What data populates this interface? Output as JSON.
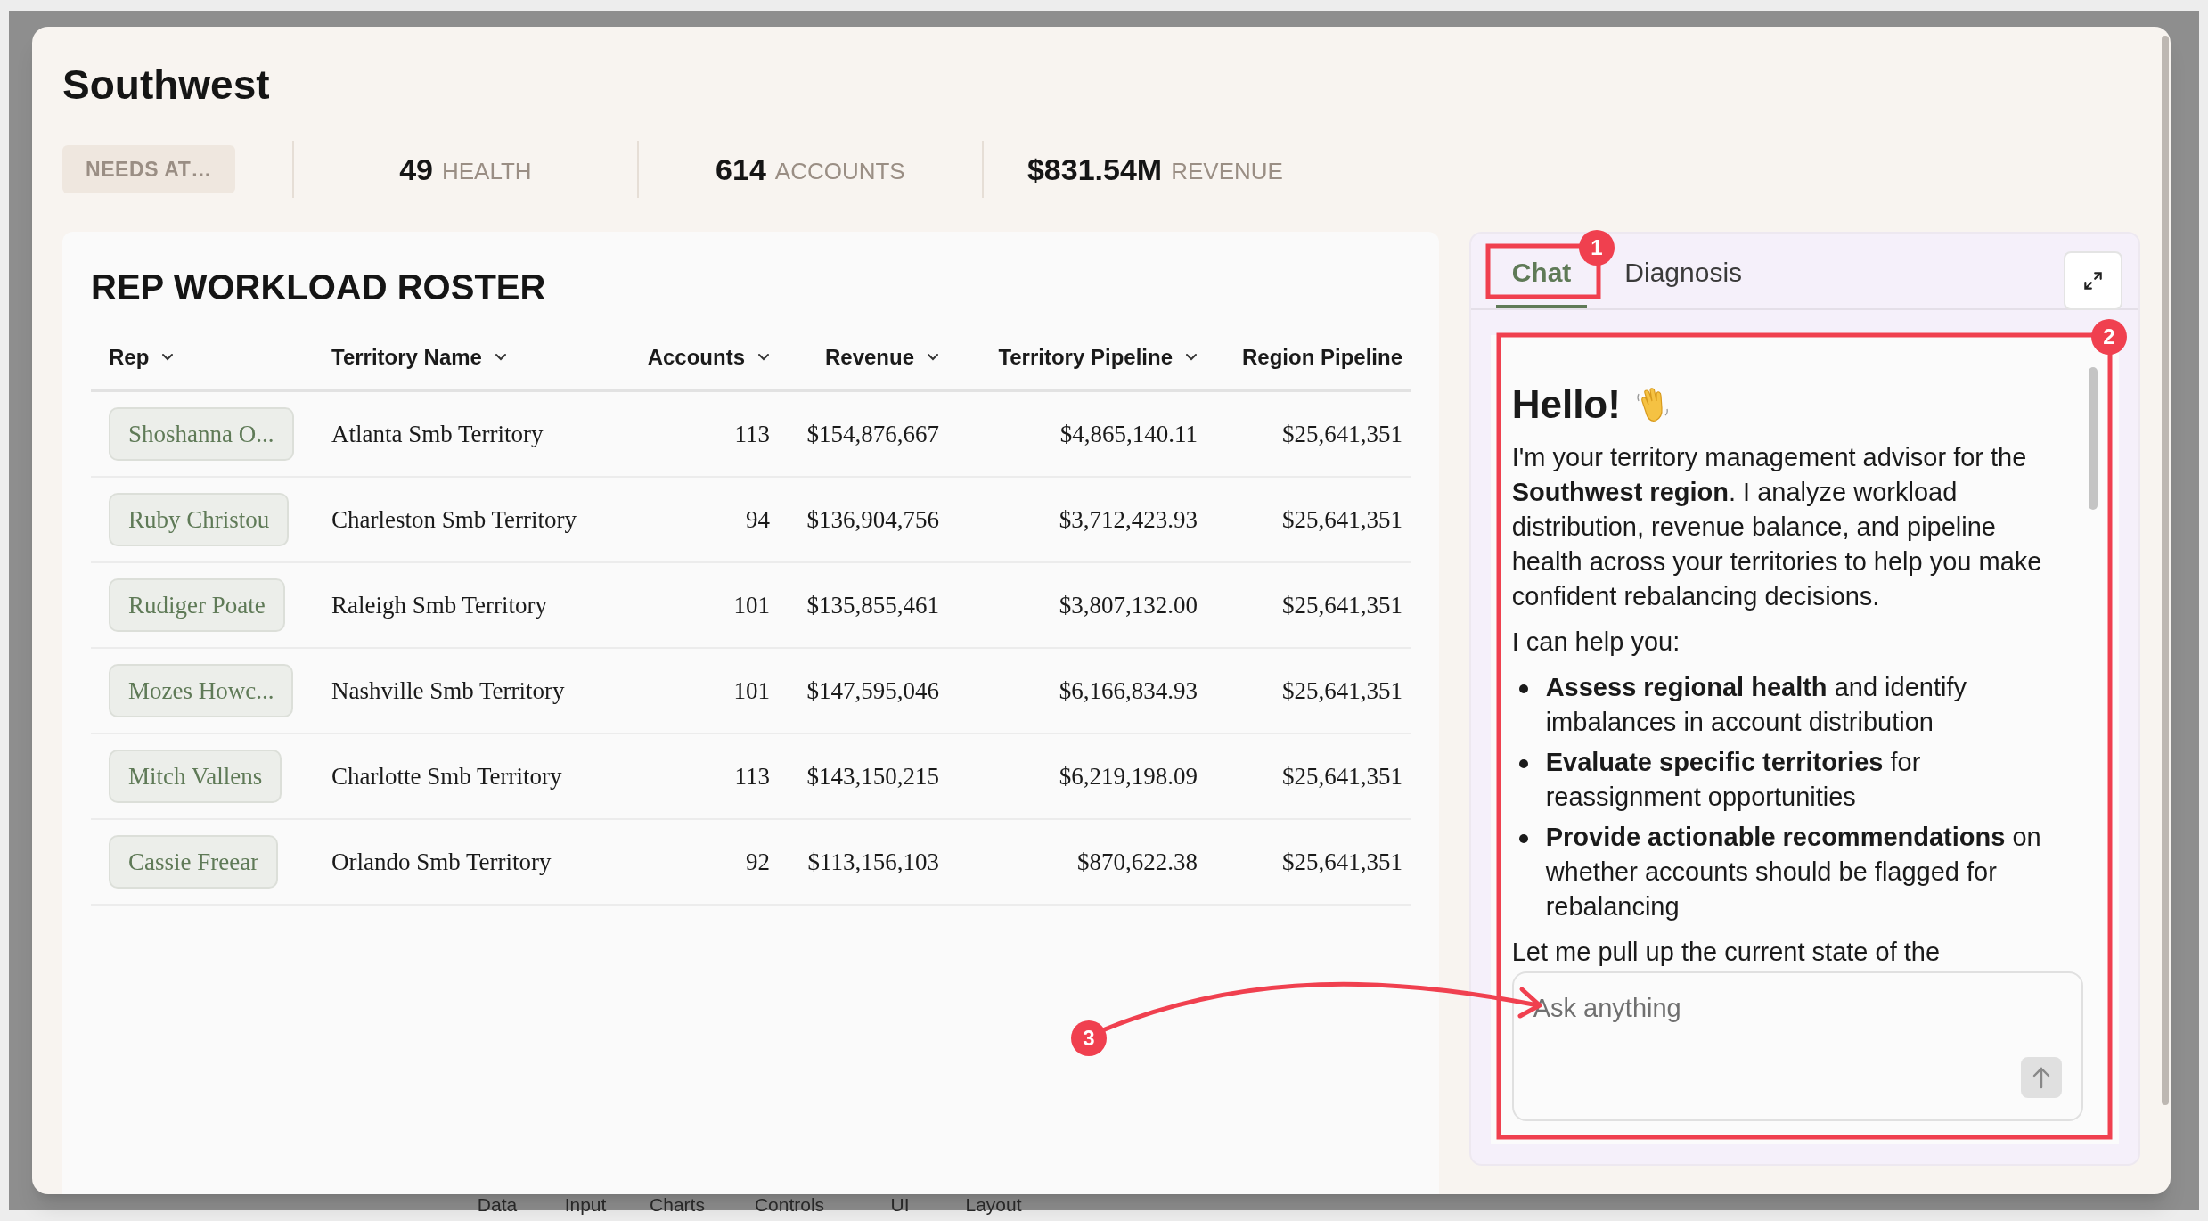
{
  "dialog": {
    "title": "Southwest",
    "status_badge": "NEEDS AT…",
    "stats": [
      {
        "value": "49",
        "label": "HEALTH"
      },
      {
        "value": "614",
        "label": "ACCOUNTS"
      },
      {
        "value": "$831.54M",
        "label": "REVENUE"
      }
    ]
  },
  "roster": {
    "title": "REP WORKLOAD ROSTER",
    "columns": [
      {
        "label": "Rep",
        "sortable": true
      },
      {
        "label": "Territory Name",
        "sortable": true
      },
      {
        "label": "Accounts",
        "sortable": true
      },
      {
        "label": "Revenue",
        "sortable": true
      },
      {
        "label": "Territory Pipeline",
        "sortable": true
      },
      {
        "label": "Region Pipeline",
        "sortable": false
      }
    ],
    "rows": [
      {
        "rep": "Shoshanna O...",
        "territory": "Atlanta Smb Territory",
        "accounts": "113",
        "revenue": "$154,876,667",
        "territory_pipeline": "$4,865,140.11",
        "region_pipeline": "$25,641,351"
      },
      {
        "rep": "Ruby Christou",
        "territory": "Charleston Smb Territory",
        "accounts": "94",
        "revenue": "$136,904,756",
        "territory_pipeline": "$3,712,423.93",
        "region_pipeline": "$25,641,351"
      },
      {
        "rep": "Rudiger Poate",
        "territory": "Raleigh Smb Territory",
        "accounts": "101",
        "revenue": "$135,855,461",
        "territory_pipeline": "$3,807,132.00",
        "region_pipeline": "$25,641,351"
      },
      {
        "rep": "Mozes Howc...",
        "territory": "Nashville Smb Territory",
        "accounts": "101",
        "revenue": "$147,595,046",
        "territory_pipeline": "$6,166,834.93",
        "region_pipeline": "$25,641,351"
      },
      {
        "rep": "Mitch Vallens",
        "territory": "Charlotte Smb Territory",
        "accounts": "113",
        "revenue": "$143,150,215",
        "territory_pipeline": "$6,219,198.09",
        "region_pipeline": "$25,641,351"
      },
      {
        "rep": "Cassie Freear",
        "territory": "Orlando Smb Territory",
        "accounts": "92",
        "revenue": "$113,156,103",
        "territory_pipeline": "$870,622.38",
        "region_pipeline": "$25,641,351"
      }
    ]
  },
  "assistant": {
    "tabs": [
      {
        "label": "Chat",
        "selected": true
      },
      {
        "label": "Diagnosis",
        "selected": false
      }
    ],
    "greeting": "Hello!",
    "paragraphs": [
      "I'm your territory management advisor for the **Southwest region**. I analyze workload distribution, revenue balance, and pipeline health across your territories to help you make confident rebalancing decisions.",
      "I can help you:"
    ],
    "bullets": [
      "**Assess regional health** and identify imbalances in account distribution",
      "**Evaluate specific territories** for reassignment opportunities",
      "**Provide actionable recommendations** on whether accounts should be flagged for rebalancing"
    ],
    "trailing_text": "Let me pull up the current state of the",
    "input": {
      "placeholder": "Ask anything"
    }
  },
  "background_toolbar": [
    "Data",
    "Input",
    "Charts",
    "Controls",
    "UI",
    "Layout"
  ],
  "annotations": [
    {
      "label": "1"
    },
    {
      "label": "2"
    },
    {
      "label": "3"
    }
  ]
}
